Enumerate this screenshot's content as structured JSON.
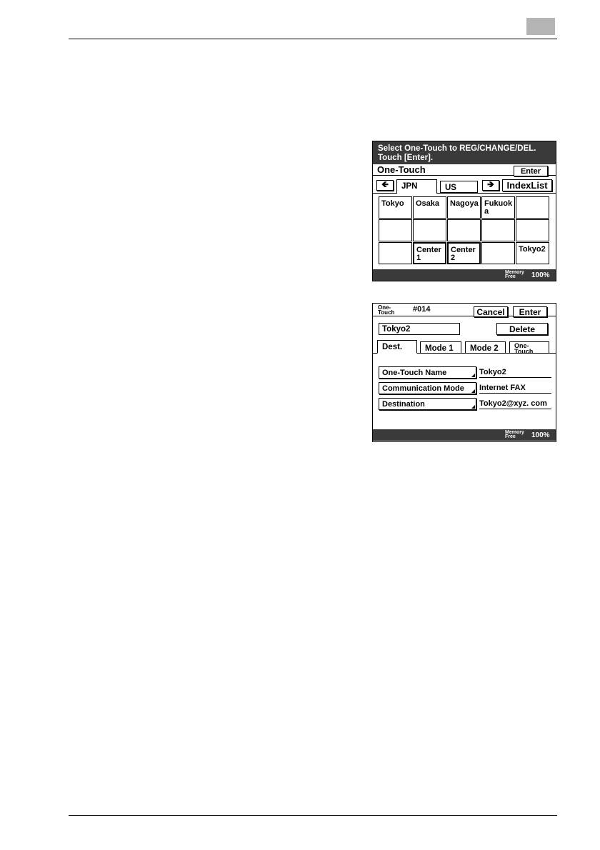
{
  "panel1": {
    "message_line1": "Select One-Touch to REG/CHANGE/DEL.",
    "message_line2": "Touch [Enter].",
    "title": "One-Touch",
    "enter_label": "Enter",
    "tabs": [
      "JPN",
      "US"
    ],
    "indexlist_label": "IndexList",
    "cells": [
      {
        "label": "Tokyo",
        "line2": ""
      },
      {
        "label": "Osaka",
        "line2": ""
      },
      {
        "label": "Nagoya",
        "line2": ""
      },
      {
        "label": "Fukuok",
        "line2": "a"
      },
      {
        "label": "",
        "line2": ""
      },
      {
        "label": "",
        "line2": ""
      },
      {
        "label": "",
        "line2": ""
      },
      {
        "label": "",
        "line2": ""
      },
      {
        "label": "",
        "line2": ""
      },
      {
        "label": "",
        "line2": ""
      },
      {
        "label": "",
        "line2": ""
      },
      {
        "label": "Center",
        "line2": "1"
      },
      {
        "label": "Center",
        "line2": "2"
      },
      {
        "label": "",
        "line2": ""
      },
      {
        "label": "Tokyo2",
        "line2": ""
      }
    ],
    "memory_label_top": "Memory",
    "memory_label_bottom": "Free",
    "memory_value": "100%"
  },
  "panel2": {
    "onetouch_top": "One-",
    "onetouch_bottom": "Touch",
    "number": "#014",
    "cancel_label": "Cancel",
    "enter_label": "Enter",
    "name_value": "Tokyo2",
    "delete_label": "Delete",
    "tabs": [
      "Dest.",
      "Mode 1",
      "Mode 2"
    ],
    "tab4_top": "One-",
    "tab4_bottom": "Touch",
    "fields": [
      {
        "button": "One-Touch Name",
        "value": "Tokyo2"
      },
      {
        "button": "Communication Mode",
        "value": "Internet FAX"
      },
      {
        "button": "Destination",
        "value": "Tokyo2@xyz. com"
      }
    ],
    "memory_label_top": "Memory",
    "memory_label_bottom": "Free",
    "memory_value": "100%"
  }
}
